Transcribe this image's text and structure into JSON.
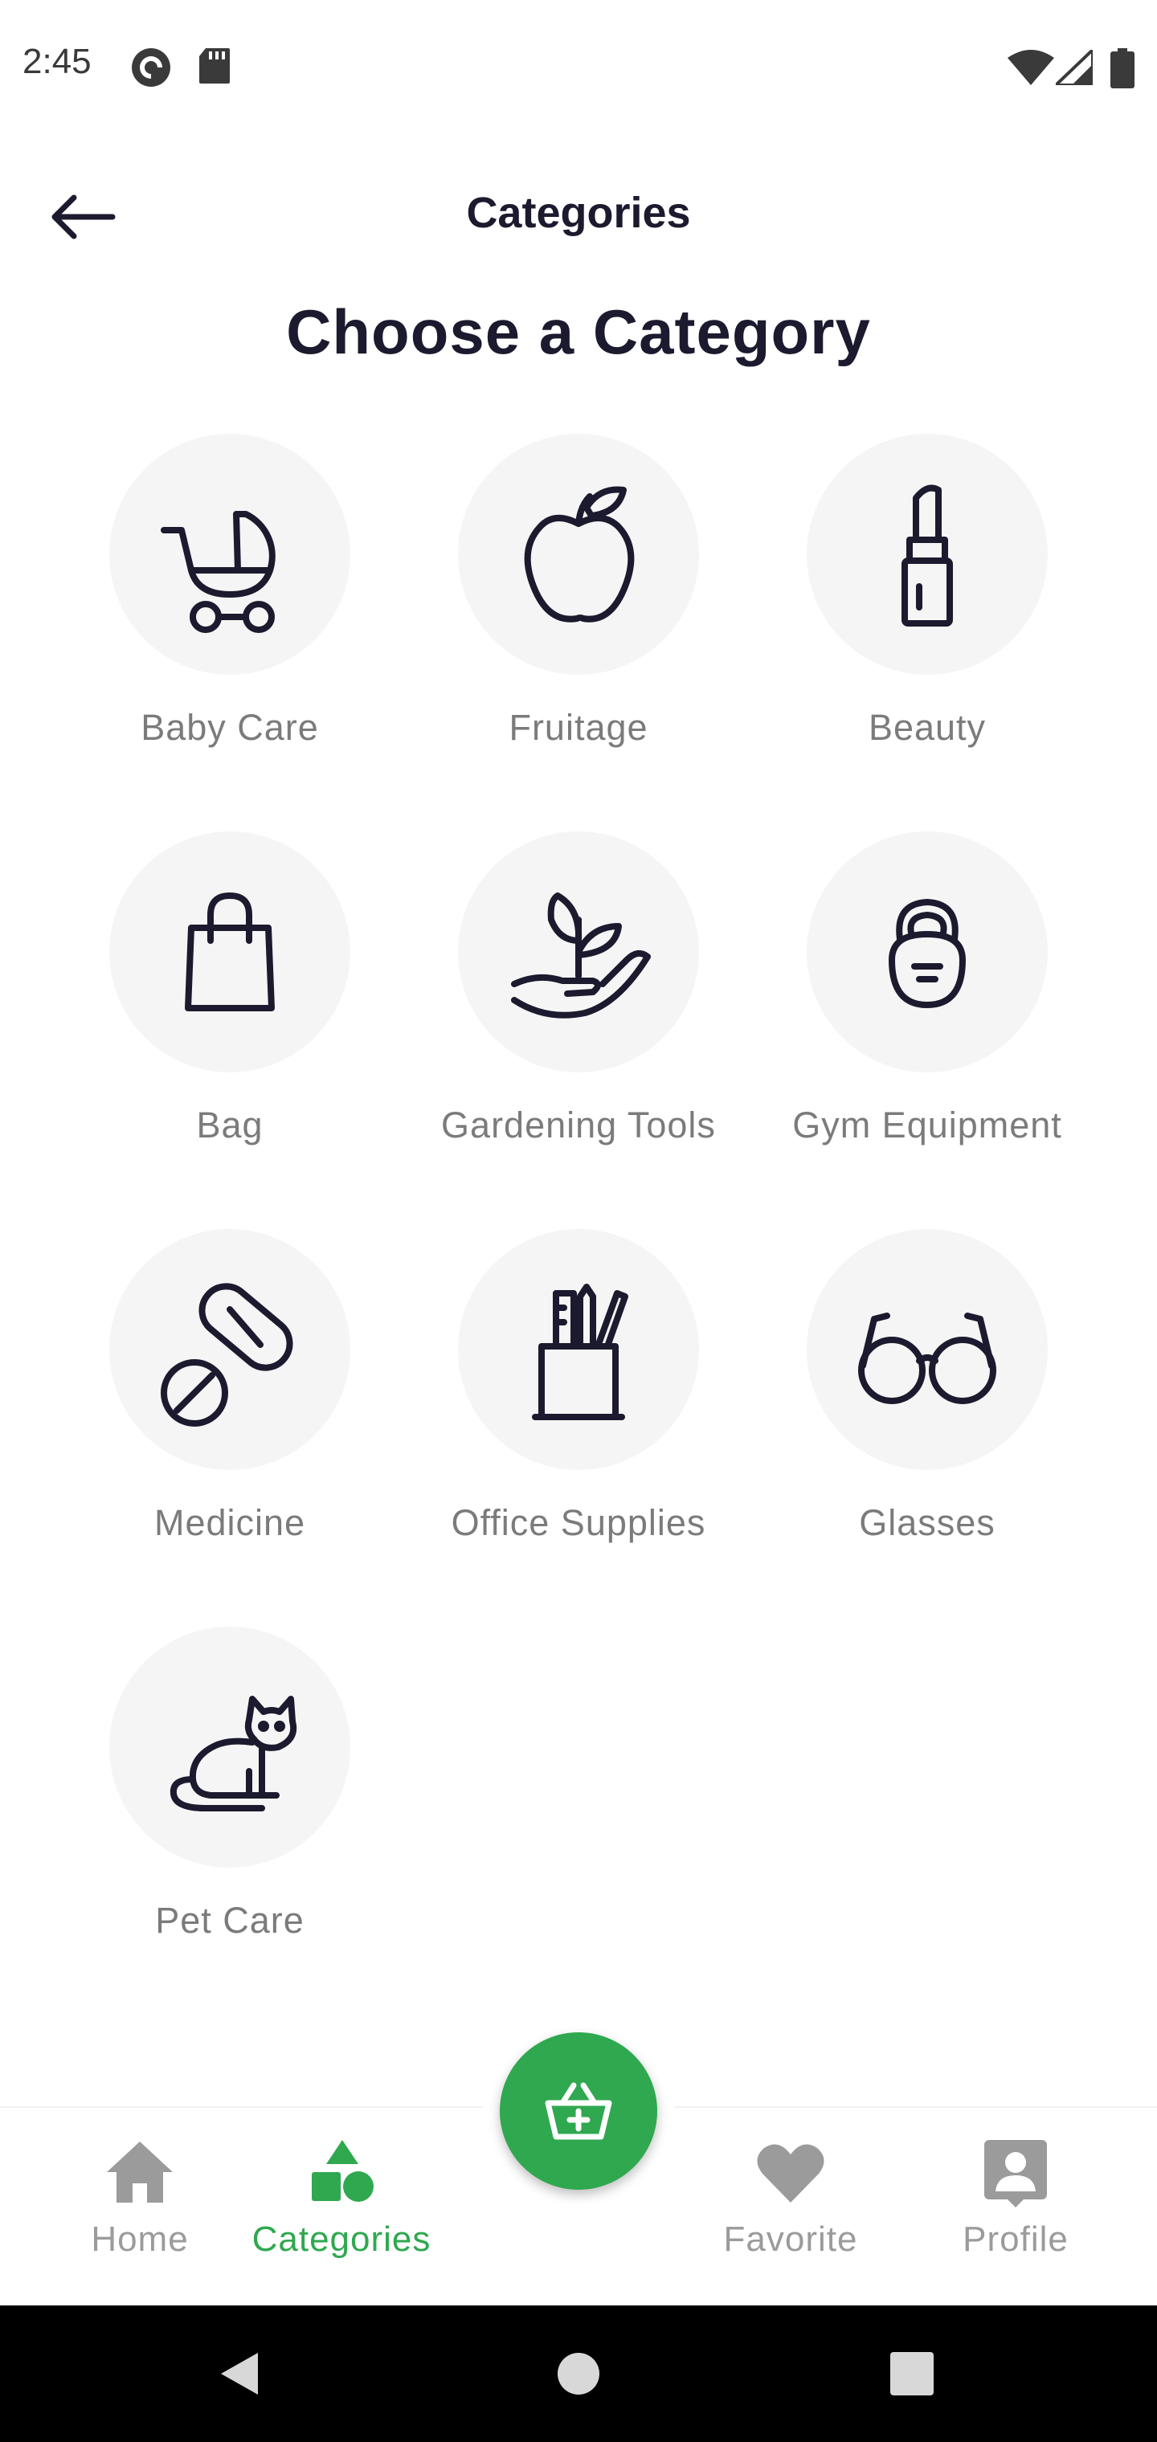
{
  "status_bar": {
    "time": "2:45",
    "icons": [
      "pocket-casts-icon",
      "sd-card-icon",
      "wifi-icon",
      "signal-icon",
      "battery-icon"
    ]
  },
  "header": {
    "back_icon": "arrow-left-icon",
    "title": "Categories"
  },
  "page_title": "Choose a Category",
  "categories": [
    {
      "label": "Baby Care",
      "icon": "stroller-icon"
    },
    {
      "label": "Fruitage",
      "icon": "apple-icon"
    },
    {
      "label": "Beauty",
      "icon": "lipstick-icon"
    },
    {
      "label": "Bag",
      "icon": "shopping-bag-icon"
    },
    {
      "label": "Gardening Tools",
      "icon": "plant-in-hand-icon"
    },
    {
      "label": "Gym Equipment",
      "icon": "kettlebell-icon"
    },
    {
      "label": "Medicine",
      "icon": "pill-icon"
    },
    {
      "label": "Office Supplies",
      "icon": "pencil-cup-icon"
    },
    {
      "label": "Glasses",
      "icon": "glasses-icon"
    },
    {
      "label": "Pet Care",
      "icon": "cat-icon"
    }
  ],
  "bottom_nav": {
    "items": [
      {
        "label": "Home",
        "icon": "home-icon",
        "active": false
      },
      {
        "label": "Categories",
        "icon": "shapes-icon",
        "active": true
      },
      {
        "label": "Favorite",
        "icon": "heart-icon",
        "active": false
      },
      {
        "label": "Profile",
        "icon": "profile-icon",
        "active": false
      }
    ],
    "fab_icon": "basket-plus-icon"
  },
  "colors": {
    "accent": "#2fa84f",
    "text_dark": "#1b1a2e",
    "text_muted": "#7b7b7b",
    "circle_bg": "#f5f5f5",
    "nav_inactive": "#9b9b9b"
  }
}
